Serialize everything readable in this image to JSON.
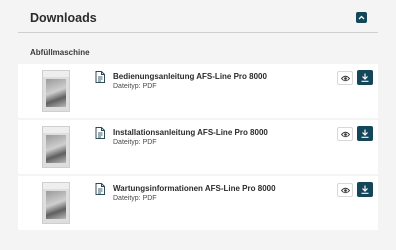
{
  "header": {
    "title": "Downloads",
    "collapse_icon": "chevron-up-icon"
  },
  "section": {
    "title": "Abfüllmaschine"
  },
  "documents": [
    {
      "name": "Bedienungsanleitung AFS-Line Pro 8000",
      "type": "Dateityp: PDF"
    },
    {
      "name": "Installationsanleitung AFS-Line Pro 8000",
      "type": "Dateityp: PDF"
    },
    {
      "name": "Wartungsinformationen AFS-Line Pro 8000",
      "type": "Dateityp: PDF"
    }
  ],
  "icons": {
    "file": "pdf-file-icon",
    "view": "eye-icon",
    "download": "download-icon"
  },
  "colors": {
    "accent": "#14465a",
    "background": "#f4f4f4",
    "card": "#ffffff"
  }
}
